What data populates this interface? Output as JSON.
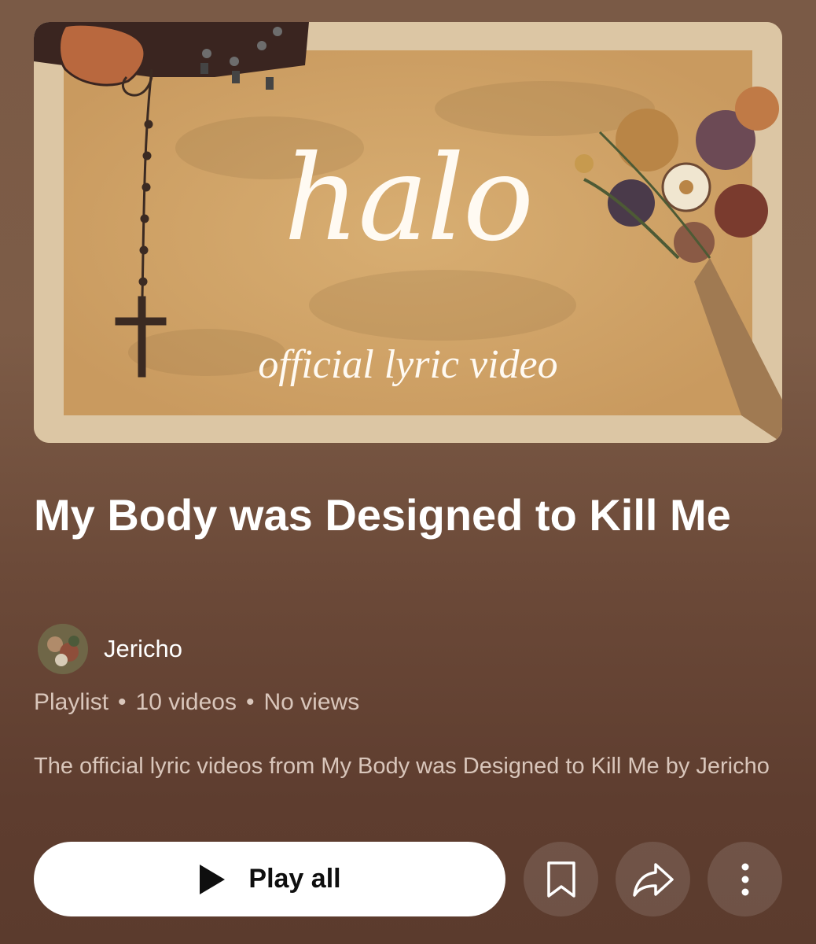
{
  "thumbnail": {
    "title_text": "halo",
    "subtitle_text": "official lyric video"
  },
  "playlist": {
    "title": "My Body was Designed to Kill Me",
    "channel_name": "Jericho",
    "type": "Playlist",
    "video_count": "10 videos",
    "views": "No views",
    "separator": "•",
    "description": "The official lyric videos from My Body was Designed to Kill Me by Jericho"
  },
  "actions": {
    "play_all_label": "Play all",
    "icons": [
      "play-icon",
      "bookmark-icon",
      "share-icon",
      "more-vertical-icon"
    ]
  },
  "colors": {
    "background_top": "#7d5c47",
    "background_bottom": "#5b3b2d",
    "secondary_text": "#d9c6bb",
    "thumbnail_frame": "#dcc6a4"
  }
}
